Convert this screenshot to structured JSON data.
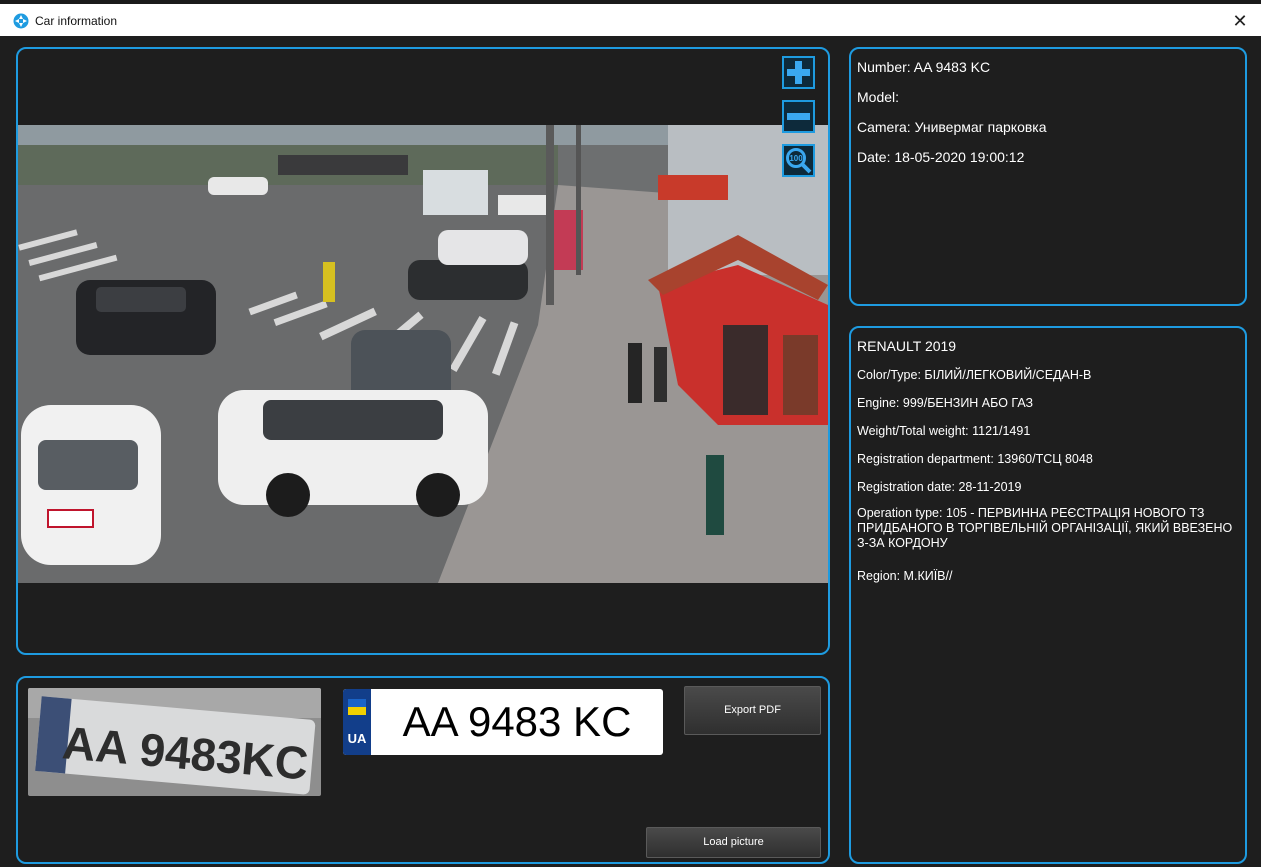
{
  "window": {
    "title": "Car information",
    "close_glyph": "✕",
    "app_icon": "car-app-icon"
  },
  "viewer": {
    "zoom_in": "zoom-in-icon",
    "zoom_out": "zoom-out-icon",
    "zoom_100": "zoom-100-icon",
    "zoom_100_label": "100",
    "scene_plates": [
      "AA 9483 KC"
    ]
  },
  "info": {
    "number": "Number: AA 9483 KC",
    "model": "Model:",
    "camera": "Camera: Универмаг парковка",
    "date": "Date: 18-05-2020 19:00:12"
  },
  "details": {
    "title": "RENAULT 2019",
    "color_type": "Color/Type: БІЛИЙ/ЛЕГКОВИЙ/СЕДАН-В",
    "engine": "Engine: 999/БЕНЗИН АБО ГАЗ",
    "weight": "Weight/Total weight: 1121/1491",
    "reg_department": "Registration department: 13960/ТСЦ 8048",
    "reg_date": "Registration date: 28-11-2019",
    "operation_type": "Operation type: 105 - ПЕРВИННА РЕЄСТРАЦІЯ НОВОГО ТЗ ПРИДБАНОГО В ТОРГІВЕЛЬНІЙ ОРГАНІЗАЦІЇ, ЯКИЙ ВВЕЗЕНО З-ЗА КОРДОНУ",
    "region": "Region: М.КИЇВ//"
  },
  "plate": {
    "country": "UA",
    "number": "AA 9483 KC",
    "crop_text": "AA 9483KC"
  },
  "buttons": {
    "export_pdf": "Export PDF",
    "load_picture": "Load picture"
  },
  "colors": {
    "accent": "#1e9be0",
    "background": "#1e1e1e",
    "plate_blue": "#123e8a",
    "flag_yellow": "#f2d000"
  }
}
